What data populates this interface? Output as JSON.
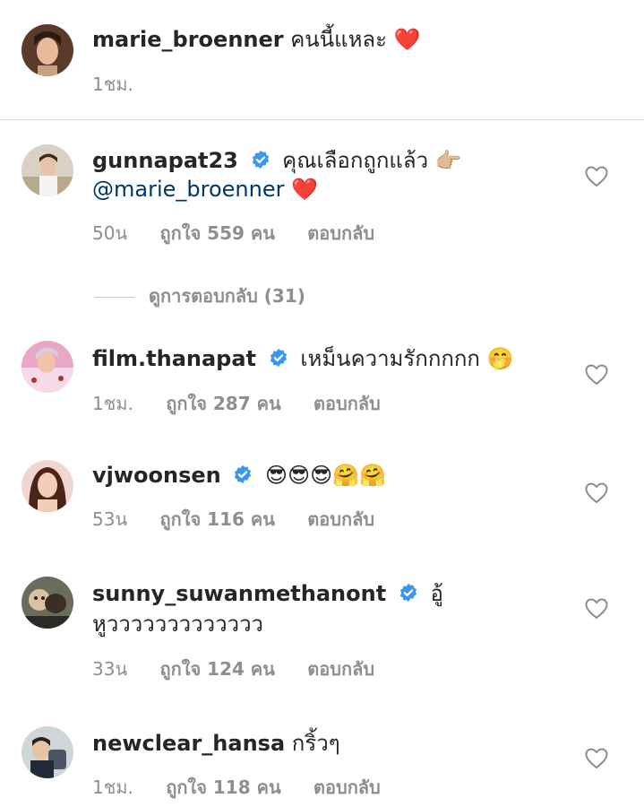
{
  "caption": {
    "username": "marie_broenner",
    "text": "คนนี้แหละ",
    "emoji": "❤️",
    "time": "1ชม."
  },
  "comments": [
    {
      "username": "gunnapat23",
      "verified": true,
      "text": "คุณเลือกถูกแล้ว",
      "emoji": "👉🏼",
      "mention": "@marie_broenner",
      "mention_emoji": "❤️",
      "time": "50น",
      "likes": "ถูกใจ 559 คน",
      "reply": "ตอบกลับ"
    },
    {
      "username": "film.thanapat",
      "verified": true,
      "text": "เหม็นความรักกกกก",
      "emoji": "🤭",
      "time": "1ชม.",
      "likes": "ถูกใจ 287 คน",
      "reply": "ตอบกลับ"
    },
    {
      "username": "vjwoonsen",
      "verified": true,
      "text": "",
      "emoji": "😎😎😎🤗🤗",
      "time": "53น",
      "likes": "ถูกใจ 116 คน",
      "reply": "ตอบกลับ"
    },
    {
      "username": "sunny_suwanmethanont",
      "verified": true,
      "text": "อู้",
      "text_line2": "หูววววววววววววว",
      "time": "33น",
      "likes": "ถูกใจ 124 คน",
      "reply": "ตอบกลับ"
    },
    {
      "username": "newclear_hansa",
      "verified": false,
      "text": "กริ้วๆ",
      "time": "1ชม.",
      "likes": "ถูกใจ 118 คน",
      "reply": "ตอบกลับ"
    }
  ],
  "view_replies": "ดูการตอบกลับ (31)",
  "icons": {
    "heart": "heart-outline-icon",
    "verified": "verified-badge-icon"
  },
  "colors": {
    "verified": "#3897f0",
    "mention": "#00376b",
    "meta": "#8e8e8e"
  }
}
